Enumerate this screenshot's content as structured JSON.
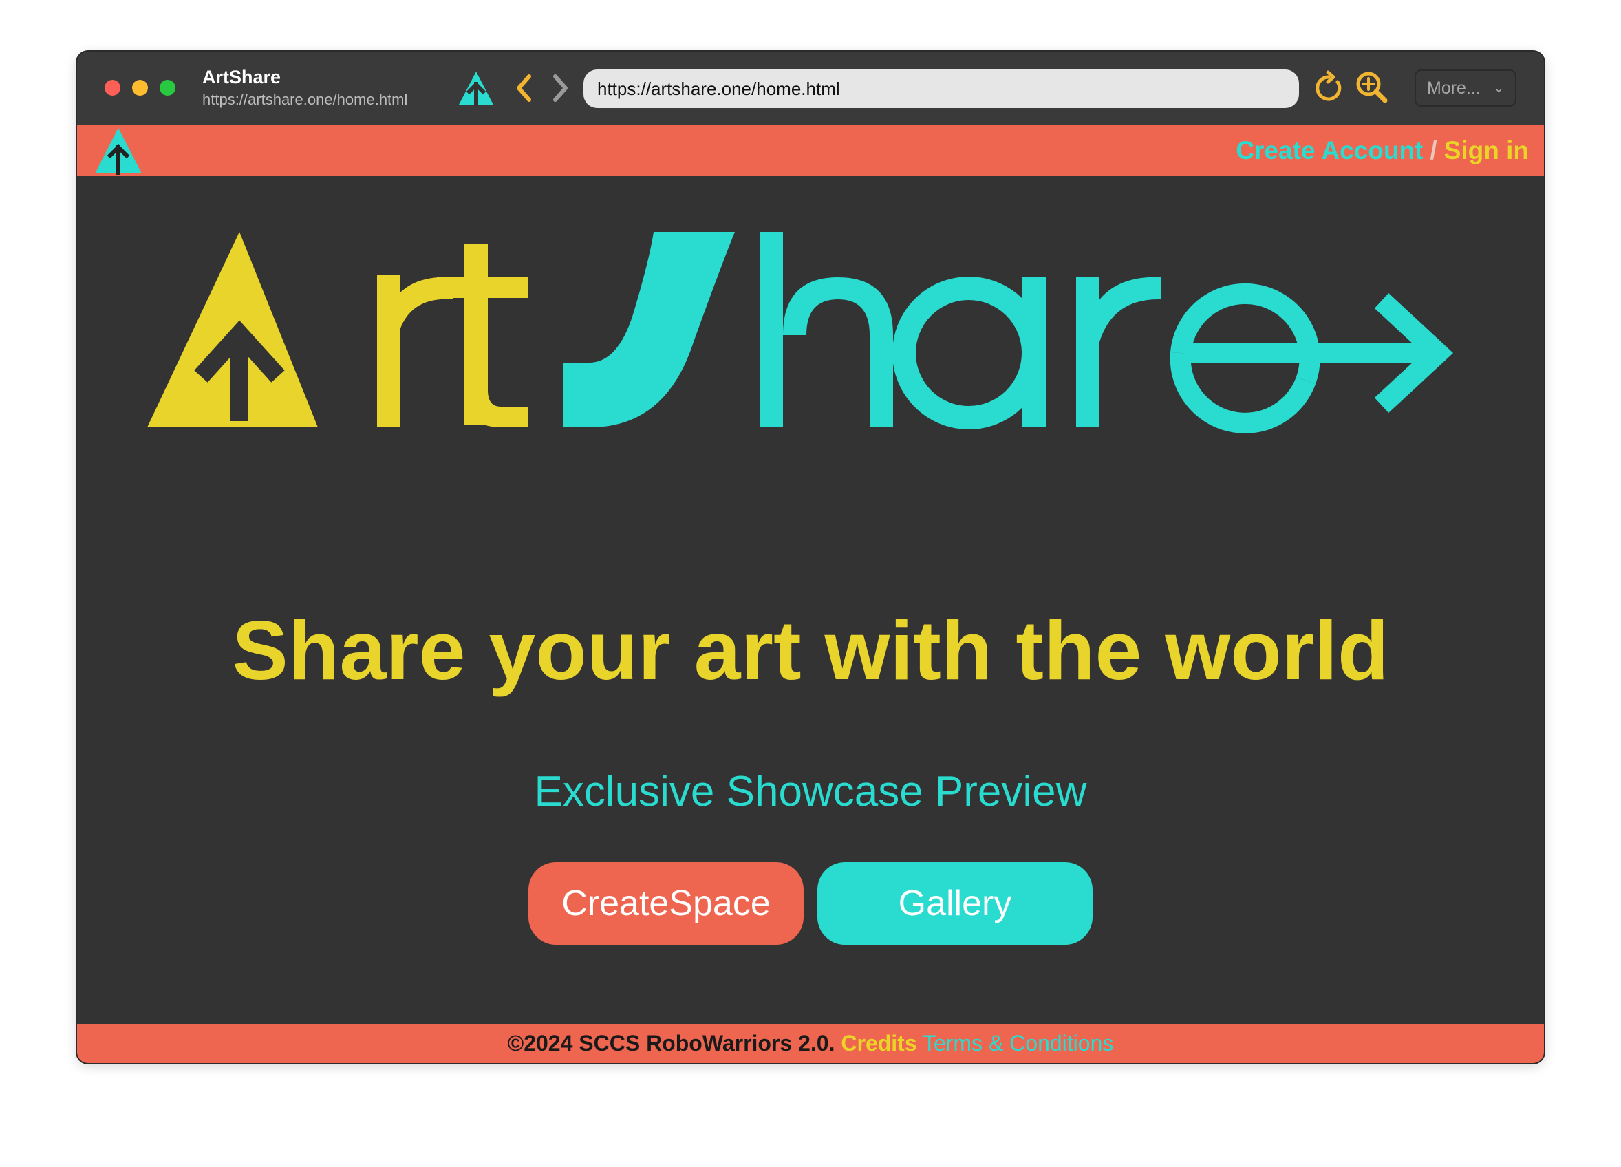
{
  "browser": {
    "title": "ArtShare",
    "subtitle_url": "https://artshare.one/home.html",
    "address": "https://artshare.one/home.html",
    "more_label": "More...",
    "icons": [
      "artshare-logo-icon",
      "back-chevron-icon",
      "forward-chevron-icon",
      "reload-icon",
      "zoom-icon",
      "chevron-down-icon"
    ]
  },
  "header": {
    "create_account": "Create Account",
    "separator": "/",
    "sign_in": "Sign in"
  },
  "hero": {
    "logo_text": "ArtShare",
    "tagline": "Share your art with the world",
    "subtitle": "Exclusive Showcase Preview"
  },
  "buttons": {
    "createspace": "CreateSpace",
    "gallery": "Gallery"
  },
  "footer": {
    "copyright": "©2024 SCCS RoboWarriors 2.0.",
    "credits": "Credits",
    "terms": "Terms & Conditions"
  },
  "colors": {
    "background": "#333333",
    "coral": "#ee6550",
    "yellow": "#e8d42b",
    "teal": "#2adbd0"
  }
}
